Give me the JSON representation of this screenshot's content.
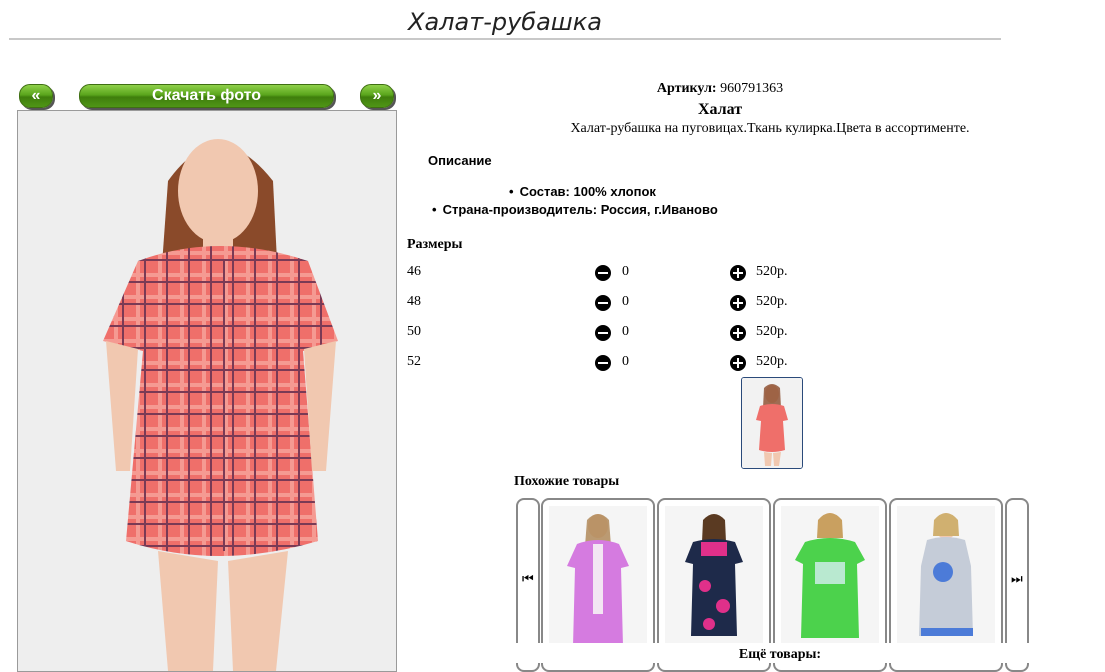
{
  "page": {
    "title": "Халат-рубашка"
  },
  "gallery": {
    "prev_label": "«",
    "download_label": "Скачать фото",
    "next_label": "»"
  },
  "product": {
    "article_label": "Артикул:",
    "article_value": "960791363",
    "type": "Халат",
    "short_description": "Халат-рубашка на пуговицах.Ткань кулирка.Цвета в ассортименте.",
    "description_title": "Описание",
    "composition": "Состав: 100% хлопок",
    "country": "Страна-производитель: Россия, г.Иваново"
  },
  "sizes": {
    "title": "Размеры",
    "rows": [
      {
        "size": "46",
        "qty": "0",
        "price": "520р."
      },
      {
        "size": "48",
        "qty": "0",
        "price": "520р."
      },
      {
        "size": "50",
        "qty": "0",
        "price": "520р."
      },
      {
        "size": "52",
        "qty": "0",
        "price": "520р."
      }
    ]
  },
  "similar": {
    "title": "Похожие товары",
    "prev_icon": "skip-back-icon",
    "next_icon": "skip-forward-icon",
    "more_label": "Ещё товары:"
  },
  "colors": {
    "button_green": "#5aa51c",
    "plaid_main": "#ef6f6a",
    "plaid_line": "#7a3a55"
  }
}
